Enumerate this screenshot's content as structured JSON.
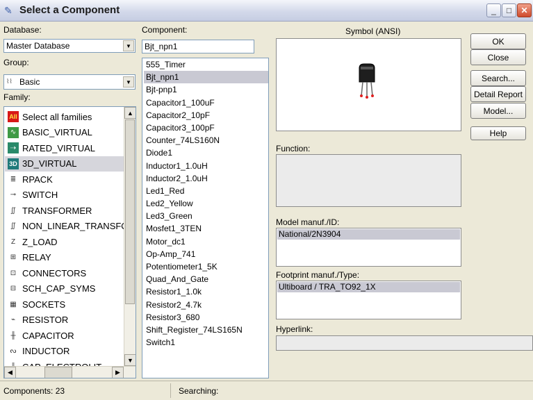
{
  "window": {
    "title": "Select a Component"
  },
  "database": {
    "label": "Database:",
    "value": "Master Database"
  },
  "group": {
    "label": "Group:",
    "value": "Basic"
  },
  "family": {
    "label": "Family:",
    "items": [
      {
        "label": "Select all families",
        "icon": "all-families-icon"
      },
      {
        "label": "BASIC_VIRTUAL",
        "icon": "basic-virtual-icon"
      },
      {
        "label": "RATED_VIRTUAL",
        "icon": "rated-virtual-icon"
      },
      {
        "label": "3D_VIRTUAL",
        "icon": "3d-virtual-icon"
      },
      {
        "label": "RPACK",
        "icon": "rpack-icon"
      },
      {
        "label": "SWITCH",
        "icon": "switch-icon"
      },
      {
        "label": "TRANSFORMER",
        "icon": "transformer-icon"
      },
      {
        "label": "NON_LINEAR_TRANSFO",
        "icon": "nonlinear-transformer-icon"
      },
      {
        "label": "Z_LOAD",
        "icon": "z-load-icon"
      },
      {
        "label": "RELAY",
        "icon": "relay-icon"
      },
      {
        "label": "CONNECTORS",
        "icon": "connectors-icon"
      },
      {
        "label": "SCH_CAP_SYMS",
        "icon": "sch-cap-syms-icon"
      },
      {
        "label": "SOCKETS",
        "icon": "sockets-icon"
      },
      {
        "label": "RESISTOR",
        "icon": "resistor-icon"
      },
      {
        "label": "CAPACITOR",
        "icon": "capacitor-icon"
      },
      {
        "label": "INDUCTOR",
        "icon": "inductor-icon"
      },
      {
        "label": "CAP_ELECTROLIT",
        "icon": "cap-electrolit-icon"
      }
    ],
    "selected_index": 3
  },
  "component": {
    "label": "Component:",
    "value": "Bjt_npn1",
    "items": [
      "555_Timer",
      "Bjt_npn1",
      "Bjt-pnp1",
      "Capacitor1_100uF",
      "Capacitor2_10pF",
      "Capacitor3_100pF",
      "Counter_74LS160N",
      "Diode1",
      "Inductor1_1.0uH",
      "Inductor2_1.0uH",
      "Led1_Red",
      "Led2_Yellow",
      "Led3_Green",
      "Mosfet1_3TEN",
      "Motor_dc1",
      "Op-Amp_741",
      "Potentiometer1_5K",
      "Quad_And_Gate",
      "Resistor1_1.0k",
      "Resistor2_4.7k",
      "Resistor3_680",
      "Shift_Register_74LS165N",
      "Switch1"
    ],
    "selected_index": 1
  },
  "symbol": {
    "label": "Symbol (ANSI)"
  },
  "function": {
    "label": "Function:"
  },
  "model": {
    "label": "Model manuf./ID:",
    "value": "National/2N3904"
  },
  "footprint": {
    "label": "Footprint manuf./Type:",
    "value": "Ultiboard / TRA_TO92_1X"
  },
  "hyperlink": {
    "label": "Hyperlink:"
  },
  "buttons": {
    "ok": "OK",
    "close": "Close",
    "search": "Search...",
    "detail_report": "Detail Report",
    "model": "Model...",
    "help": "Help"
  },
  "status": {
    "components": "Components: 23",
    "searching": "Searching:"
  },
  "colors": {
    "selection": "#c9c9d3",
    "transistor_body": "#1e1e1e",
    "pin_tip": "#e02020"
  }
}
